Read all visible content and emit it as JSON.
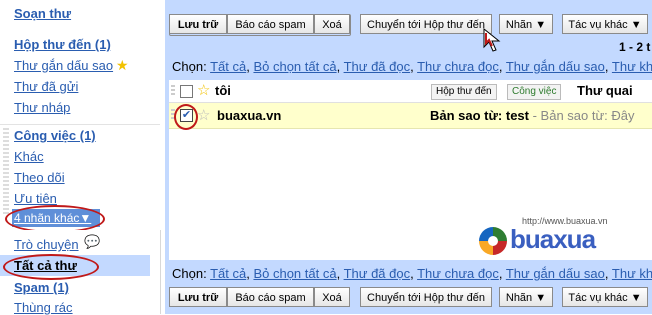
{
  "sidebar": {
    "compose": "Soạn thư",
    "inbox": "Hộp thư đến (1)",
    "starred": "Thư gắn dấu sao",
    "sent": "Thư đã gửi",
    "drafts": "Thư nháp",
    "labels": [
      "Công việc (1)",
      "Khác",
      "Theo dõi",
      "Ưu tiên"
    ],
    "more_labels": "4 nhãn khác▼",
    "chats": "Trò chuyện",
    "all_mail": "Tất cả thư",
    "spam": "Spam (1)",
    "trash": "Thùng rác"
  },
  "toolbar": {
    "archive": "Lưu trữ",
    "report_spam": "Báo cáo spam",
    "delete": "Xoá",
    "move_to_inbox": "Chuyển tới Hộp thư đến",
    "labels": "Nhãn ▼",
    "more_actions": "Tác vụ khác ▼",
    "count": "1 - 2 t"
  },
  "select_bar": {
    "prefix": "Chọn:",
    "options": [
      "Tất cả",
      "Bỏ chọn tất cả",
      "Thư đã đọc",
      "Thư chưa đọc",
      "Thư gắn dấu sao",
      "Thư kh"
    ]
  },
  "messages": [
    {
      "sender": "tôi",
      "chips": [
        "Hộp thư đến",
        "Công việc"
      ],
      "subject": "Thư quai",
      "snippet": ""
    },
    {
      "sender": "buaxua.vn",
      "chips": [],
      "subject": "Bản sao từ: test",
      "snippet": " - Bản sao từ: Đây"
    }
  ],
  "watermark": {
    "url": "http://www.buaxua.vn",
    "brand": "buaxua"
  },
  "colors": {
    "frame": "#c3d9ff",
    "link": "#2a5db0",
    "selected_row": "#ffffcc",
    "highlight": "#c01919"
  }
}
